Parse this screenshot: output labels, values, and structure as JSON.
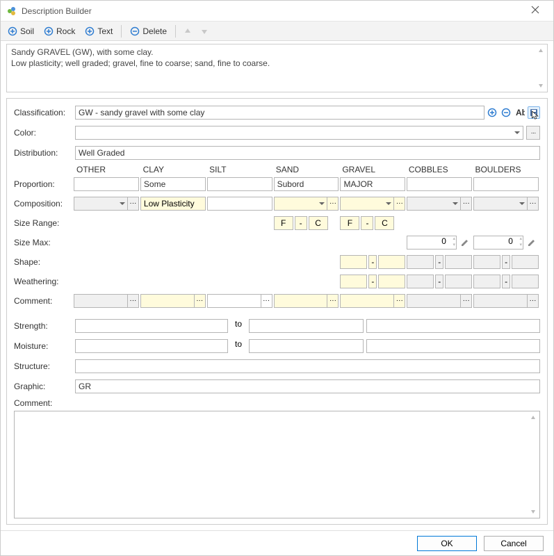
{
  "window": {
    "title": "Description Builder"
  },
  "toolbar": {
    "soil": "Soil",
    "rock": "Rock",
    "text": "Text",
    "delete": "Delete"
  },
  "preview": {
    "line1": "Sandy GRAVEL (GW), with some clay.",
    "line2": "Low plasticity; well graded; gravel, fine to coarse; sand, fine to coarse."
  },
  "labels": {
    "classification": "Classification:",
    "color": "Color:",
    "distribution": "Distribution:",
    "proportion": "Proportion:",
    "composition": "Composition:",
    "sizeRange": "Size Range:",
    "sizeMax": "Size Max:",
    "shape": "Shape:",
    "weathering": "Weathering:",
    "comment": "Comment:",
    "strength": "Strength:",
    "moisture": "Moisture:",
    "structure": "Structure:",
    "graphic": "Graphic:",
    "comment2": "Comment:",
    "to": "to"
  },
  "fields": {
    "classification": "GW - sandy gravel with some clay",
    "color": "",
    "distribution": "Well Graded",
    "structure": "",
    "graphic": "GR",
    "strength_from": "",
    "strength_to": "",
    "strength_extra": "",
    "moisture_from": "",
    "moisture_to": "",
    "moisture_extra": ""
  },
  "columns": [
    "OTHER",
    "CLAY",
    "SILT",
    "SAND",
    "GRAVEL",
    "COBBLES",
    "BOULDERS"
  ],
  "proportion": {
    "OTHER": "",
    "CLAY": "Some",
    "SILT": "",
    "SAND": "Subord",
    "GRAVEL": "MAJOR",
    "COBBLES": "",
    "BOULDERS": ""
  },
  "composition": {
    "CLAY": "Low Plasticity"
  },
  "sizeRange": {
    "SAND": {
      "from": "F",
      "to": "C"
    },
    "GRAVEL": {
      "from": "F",
      "to": "C"
    }
  },
  "sizeMax": {
    "COBBLES": "0",
    "BOULDERS": "0"
  },
  "glyphs": {
    "dash": "-",
    "dots": "···"
  },
  "footer": {
    "ok": "OK",
    "cancel": "Cancel"
  }
}
